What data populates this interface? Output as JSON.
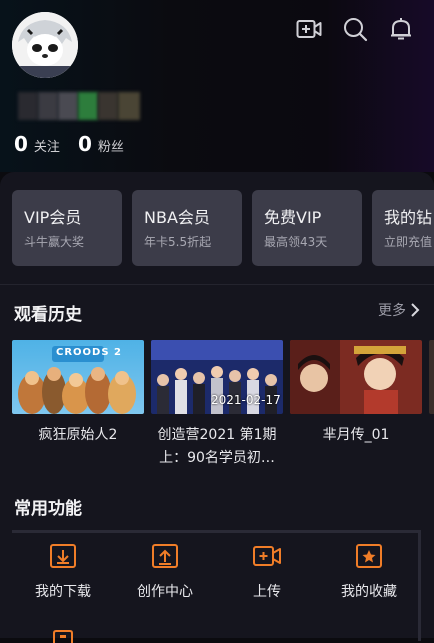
{
  "profile": {
    "following_count": "0",
    "following_label": "关注",
    "followers_count": "0",
    "followers_label": "粉丝"
  },
  "header_icons": [
    "add-video-icon",
    "search-icon",
    "bell-icon"
  ],
  "vip_cards": [
    {
      "title": "VIP会员",
      "subtitle": "斗牛赢大奖"
    },
    {
      "title": "NBA会员",
      "subtitle": "年卡5.5折起"
    },
    {
      "title": "免费VIP",
      "subtitle": "最高领43天"
    },
    {
      "title": "我的钻",
      "subtitle": "立即充值"
    }
  ],
  "history": {
    "title": "观看历史",
    "more_label": "更多",
    "items": [
      {
        "caption": "疯狂原始人2",
        "poster_text": "CROODS 2"
      },
      {
        "caption": "创造营2021 第1期上：90名学员初…",
        "date_overlay": "2021-02-17"
      },
      {
        "caption": "芈月传_01"
      }
    ]
  },
  "functions": {
    "title": "常用功能",
    "items": [
      {
        "label": "我的下载",
        "icon": "download-icon"
      },
      {
        "label": "创作中心",
        "icon": "upload-box-icon"
      },
      {
        "label": "上传",
        "icon": "camera-plus-icon"
      },
      {
        "label": "我的收藏",
        "icon": "star-box-icon"
      }
    ]
  },
  "colors": {
    "accent": "#f07d28",
    "card_bg": "#3c3c49",
    "panel_bg": "#15151e"
  }
}
